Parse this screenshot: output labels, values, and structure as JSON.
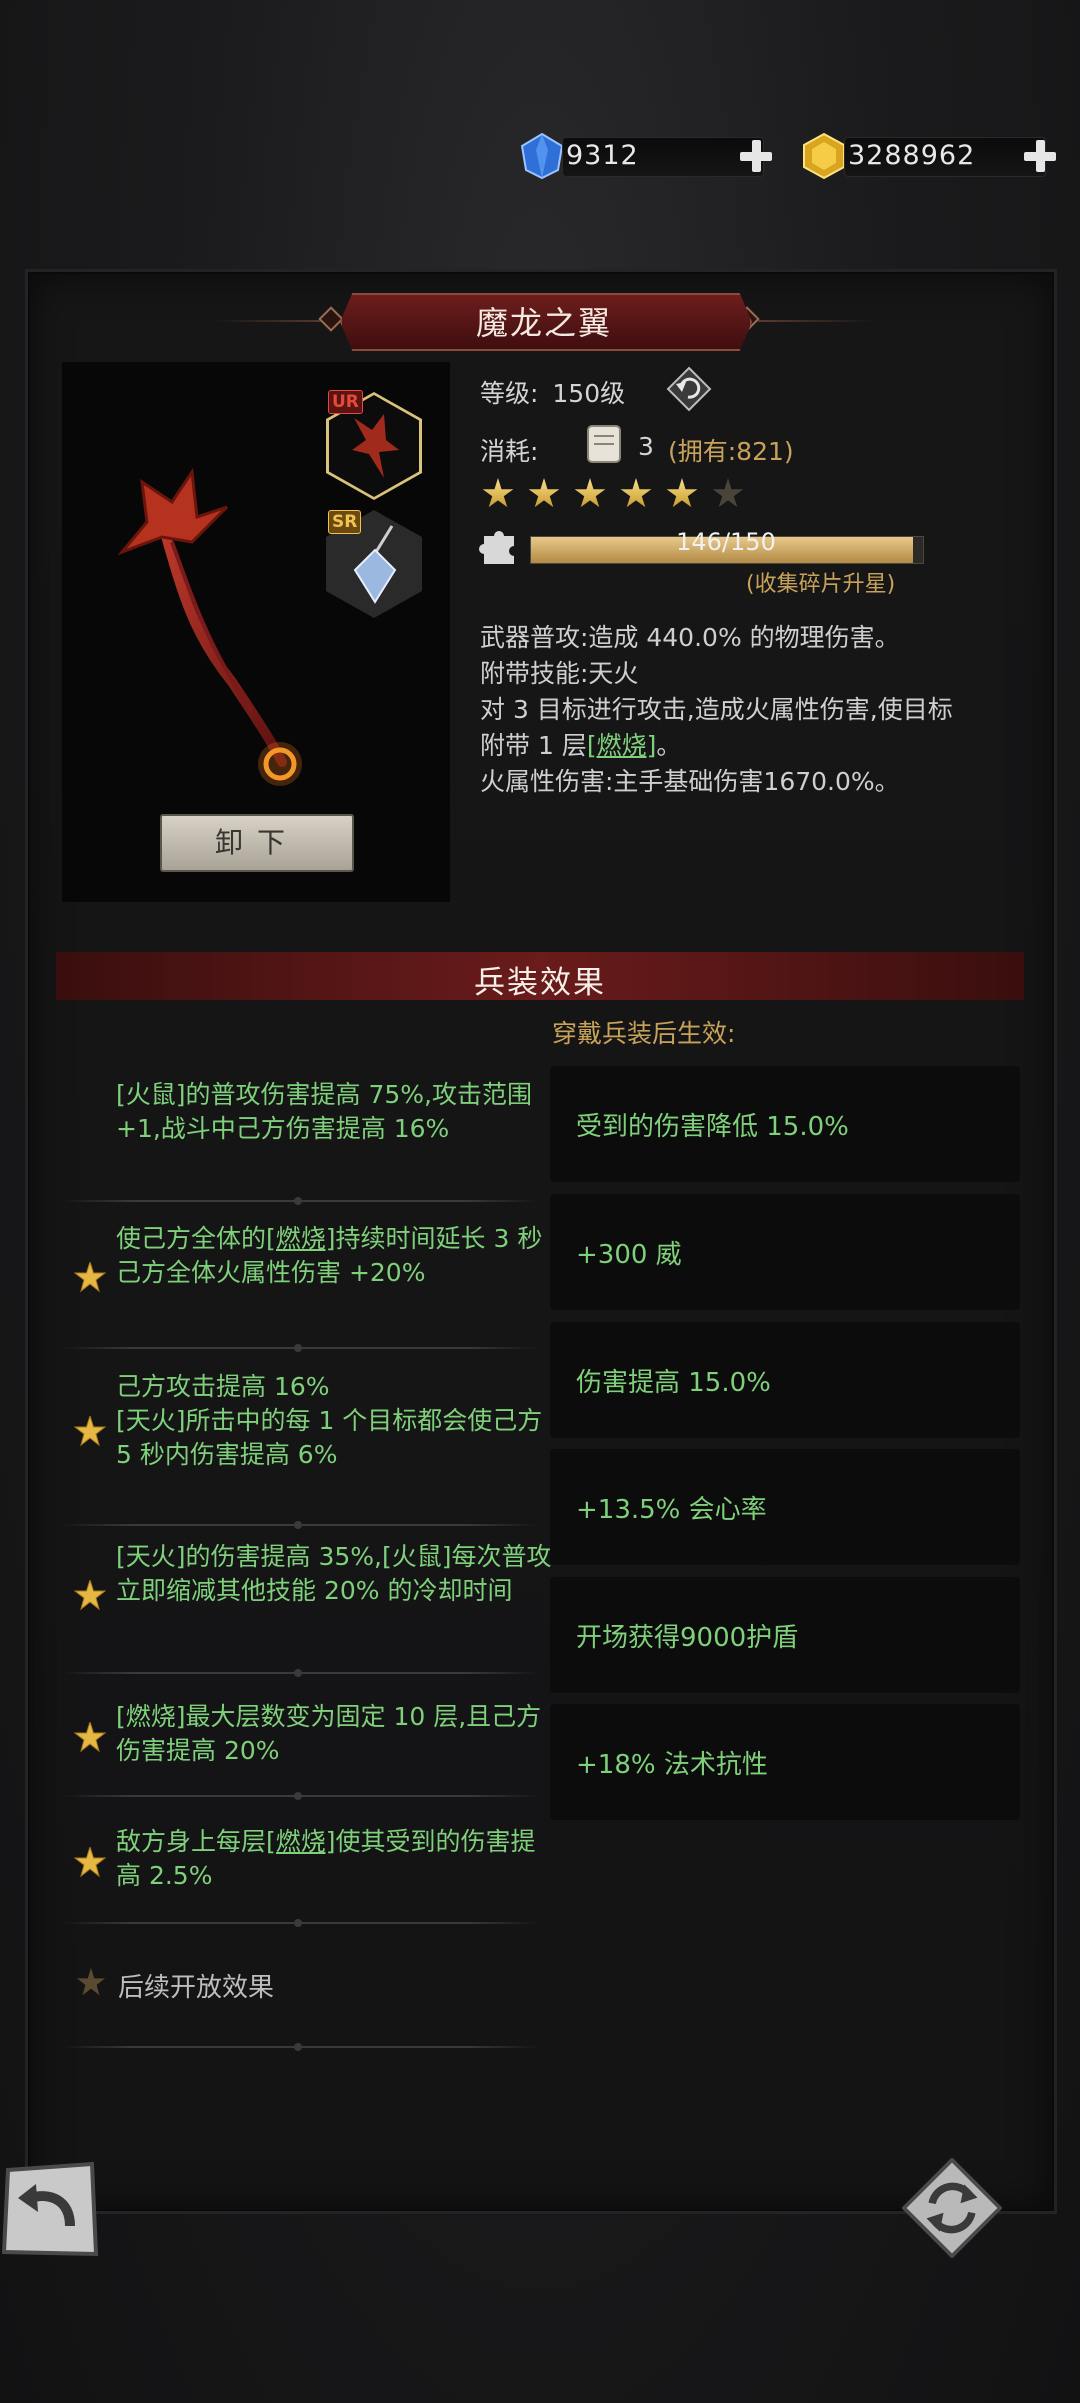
{
  "currency": {
    "gems": "9312",
    "gold": "3288962"
  },
  "item": {
    "name": "魔龙之翼",
    "slot_badges": [
      "UR",
      "SR"
    ],
    "unload_label": "卸下",
    "level_label": "等级:",
    "level_value": "150级",
    "cost_label": "消耗:",
    "cost_amount": "3",
    "cost_owned": "(拥有:821)",
    "stars": {
      "filled": 5,
      "total": 6
    },
    "fragments": {
      "current": 146,
      "max": 150,
      "text": "146/150"
    },
    "fragments_hint": "(收集碎片升星)"
  },
  "description": {
    "line1": "武器普攻:造成 440.0% 的物理伤害。",
    "line2": "附带技能:天火",
    "line3_a": "对 3 目标进行攻击,造成火属性伤害,使目标附带 1 层",
    "line3_link": "[燃烧]",
    "line3_b": "。",
    "line4": "火属性伤害:主手基础伤害1670.0%。"
  },
  "effects_section": {
    "title": "兵装效果",
    "subtitle": "穿戴兵装后生效:",
    "pending_label": "后续开放效果"
  },
  "effects": [
    {
      "pre": "[火鼠]的普攻伤害提高 75%,攻击范围+1,战斗中己方伤害提高 16%",
      "link": "",
      "post": "",
      "starred": false
    },
    {
      "pre": "使己方全体的",
      "link": "[燃烧]",
      "post": "持续时间延长 3 秒\n己方全体火属性伤害 +20%",
      "starred": true
    },
    {
      "pre": "己方攻击提高 16%\n[天火]所击中的每 1 个目标都会使己方 5 秒内伤害提高 6%",
      "link": "",
      "post": "",
      "starred": true
    },
    {
      "pre": "[天火]的伤害提高 35%,[火鼠]每次普攻立即缩减其他技能 20% 的冷却时间",
      "link": "",
      "post": "",
      "starred": true
    },
    {
      "pre": "[燃烧]最大层数变为固定 10 层,且己方伤害提高 20%",
      "link": "",
      "post": "",
      "starred": true
    },
    {
      "pre": "敌方身上每层",
      "link": "[燃烧]",
      "post": "使其受到的伤害提高 2.5%",
      "starred": true
    }
  ],
  "buffs": [
    "受到的伤害降低 15.0%",
    "+300 威",
    "伤害提高 15.0%",
    "+13.5% 会心率",
    "开场获得9000护盾",
    "+18% 法术抗性"
  ],
  "colors": {
    "effect_text": "#7fd07a",
    "gold_text": "#c9a25a",
    "banner_red": "#6a1b1b"
  }
}
